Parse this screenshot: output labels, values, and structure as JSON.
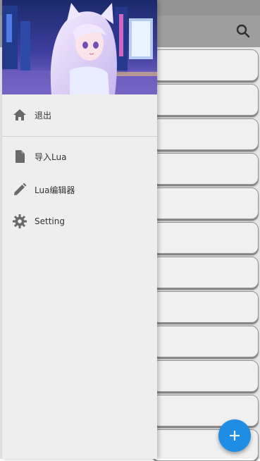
{
  "toolbar": {
    "search_icon": "search-icon"
  },
  "drawer": {
    "items": [
      {
        "label": "退出",
        "icon": "home-icon"
      },
      {
        "label": "导入Lua",
        "icon": "file-icon"
      },
      {
        "label": "Lua编辑器",
        "icon": "pencil-icon"
      },
      {
        "label": "Setting",
        "icon": "gear-icon"
      }
    ]
  },
  "fab": {
    "label": "+",
    "icon": "add-icon"
  },
  "colors": {
    "accent": "#2196f3",
    "toolbar": "#a8a8a8",
    "drawer_bg": "#eeeeee"
  }
}
